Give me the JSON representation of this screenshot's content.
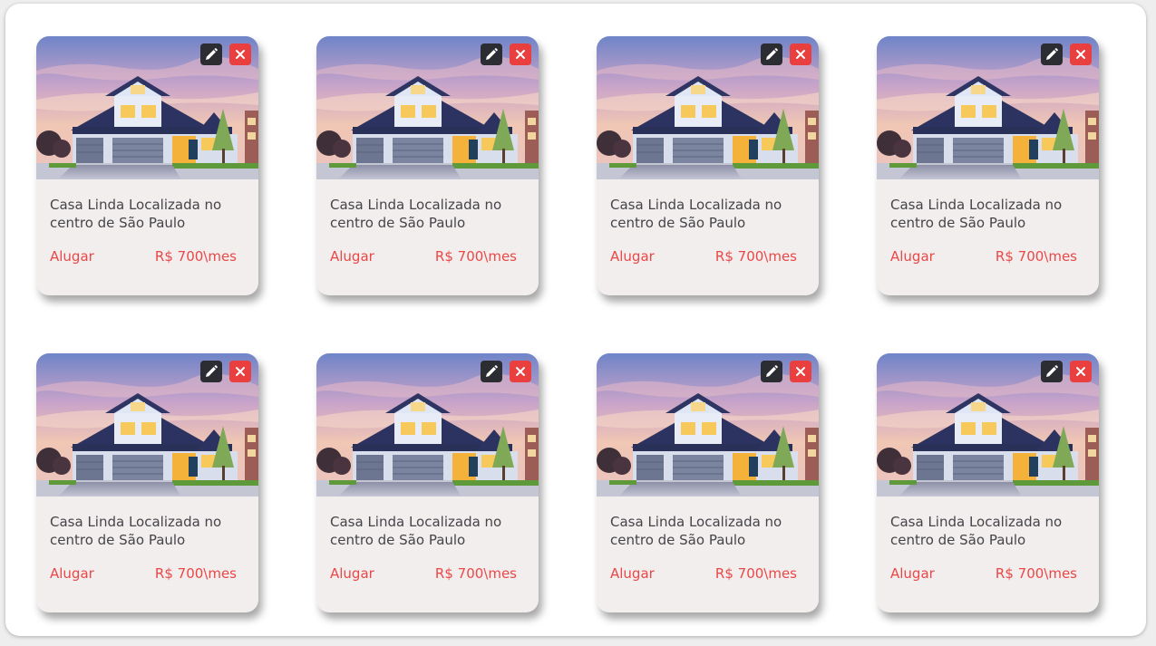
{
  "colors": {
    "accent": "#ea4747",
    "delete_button": "#ea3f3f",
    "edit_button": "#2c2c33",
    "card_background": "#f2eeee",
    "text": "#444449"
  },
  "icons": {
    "edit": "pencil-icon",
    "delete": "close-icon",
    "photo": "house-photo"
  },
  "listings": [
    {
      "title": "Casa Linda Localizada  no centro de São Paulo",
      "action": "Alugar",
      "price": "R$ 700\\mes"
    },
    {
      "title": "Casa Linda Localizada  no centro de São Paulo",
      "action": "Alugar",
      "price": "R$ 700\\mes"
    },
    {
      "title": "Casa Linda Localizada  no centro de São Paulo",
      "action": "Alugar",
      "price": "R$ 700\\mes"
    },
    {
      "title": "Casa Linda Localizada  no centro de São Paulo",
      "action": "Alugar",
      "price": "R$ 700\\mes"
    },
    {
      "title": "Casa Linda Localizada  no centro de São Paulo",
      "action": "Alugar",
      "price": "R$ 700\\mes"
    },
    {
      "title": "Casa Linda Localizada  no centro de São Paulo",
      "action": "Alugar",
      "price": "R$ 700\\mes"
    },
    {
      "title": "Casa Linda Localizada  no centro de São Paulo",
      "action": "Alugar",
      "price": "R$ 700\\mes"
    },
    {
      "title": "Casa Linda Localizada  no centro de São Paulo",
      "action": "Alugar",
      "price": "R$ 700\\mes"
    }
  ]
}
